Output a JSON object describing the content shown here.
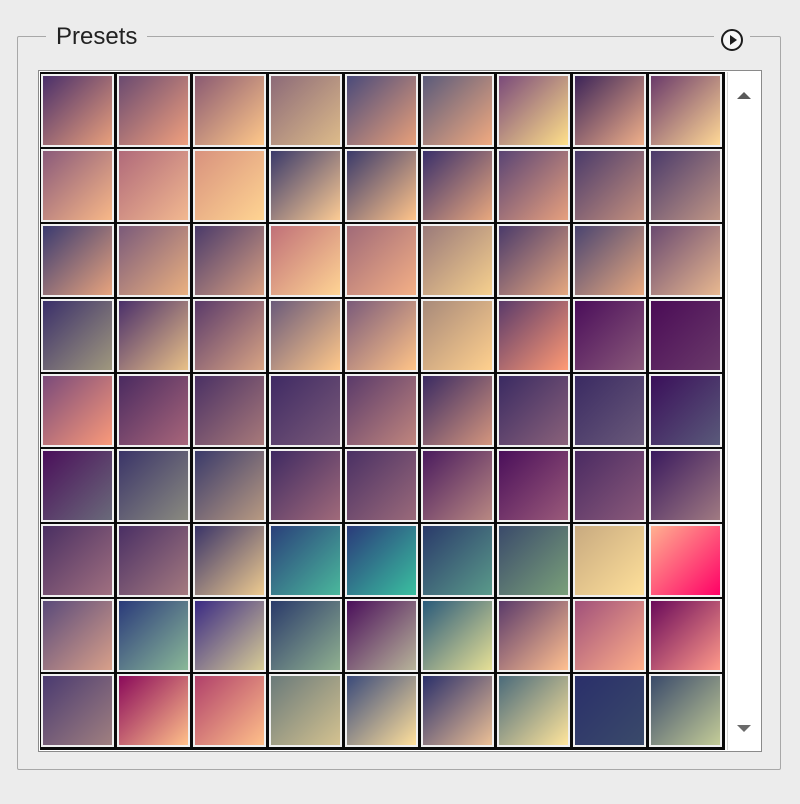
{
  "title": "Presets",
  "icons": {
    "menu": "circled-right-arrow-icon",
    "scroll_up": "triangle-up-icon",
    "scroll_down": "triangle-down-icon"
  },
  "swatches": [
    [
      "#4a2f6a",
      "#e9a07c"
    ],
    [
      "#6a4a70",
      "#f0a07e"
    ],
    [
      "#8a5a72",
      "#ffc88a"
    ],
    [
      "#8c6a78",
      "#ddbb8a"
    ],
    [
      "#4a4a7a",
      "#e8a07a"
    ],
    [
      "#5a5a7a",
      "#f1aa80"
    ],
    [
      "#7a4a7a",
      "#ffe08a"
    ],
    [
      "#3c2458",
      "#f0b08a"
    ],
    [
      "#6a3a6a",
      "#ffd896"
    ],
    [
      "#8a5a7a",
      "#f8b888"
    ],
    [
      "#b06a7a",
      "#f2b890"
    ],
    [
      "#d8927e",
      "#ffd492"
    ],
    [
      "#3a3a6a",
      "#fccb94"
    ],
    [
      "#3a3a6a",
      "#ffc48a"
    ],
    [
      "#3a2f6a",
      "#e8a87e"
    ],
    [
      "#5a4474",
      "#e6a07e"
    ],
    [
      "#4a3a6a",
      "#c4907e"
    ],
    [
      "#4a3a6a",
      "#c09686"
    ],
    [
      "#3a3a70",
      "#e8a47e"
    ],
    [
      "#7a5a7a",
      "#eab080"
    ],
    [
      "#4a3a6a",
      "#d8a082"
    ],
    [
      "#c07078",
      "#ffd494"
    ],
    [
      "#a06a78",
      "#f4b086"
    ],
    [
      "#9a7a7a",
      "#f6d08e"
    ],
    [
      "#4a3a6a",
      "#e6a880"
    ],
    [
      "#4a4470",
      "#e8aa80"
    ],
    [
      "#6a4a70",
      "#e8b890"
    ],
    [
      "#3a2f6a",
      "#a0987e"
    ],
    [
      "#4a2f6a",
      "#e8c088"
    ],
    [
      "#5a3a6a",
      "#d8a484"
    ],
    [
      "#6a5a7a",
      "#ffc88a"
    ],
    [
      "#7a5a7a",
      "#ffc488"
    ],
    [
      "#a88a7a",
      "#ffd08e"
    ],
    [
      "#5a3a6a",
      "#ff9a74"
    ],
    [
      "#4a0d5a",
      "#8a5a7a"
    ],
    [
      "#4a0b56",
      "#6a3a6a"
    ],
    [
      "#7a4a7a",
      "#fa9a7a"
    ],
    [
      "#4a2a60",
      "#a8667a"
    ],
    [
      "#4a3064",
      "#a87a7a"
    ],
    [
      "#3f2a64",
      "#7a5a78"
    ],
    [
      "#5a3a6a",
      "#c0867e"
    ],
    [
      "#3a2a62",
      "#d4967e"
    ],
    [
      "#3a2a62",
      "#8a627a"
    ],
    [
      "#3a2a62",
      "#6a5a7a"
    ],
    [
      "#3a0f5a",
      "#5a5a7a"
    ],
    [
      "#4a0f5a",
      "#6a6a7a"
    ],
    [
      "#3a3468",
      "#8a8a80"
    ],
    [
      "#3a3a6a",
      "#b89a82"
    ],
    [
      "#3f2a62",
      "#a06a7a"
    ],
    [
      "#4a3064",
      "#9a6a7a"
    ],
    [
      "#4a1b5e",
      "#b88882"
    ],
    [
      "#4a0f5a",
      "#9a5a7a"
    ],
    [
      "#4a2a62",
      "#8a5a7a"
    ],
    [
      "#3a1a5e",
      "#a07a82"
    ],
    [
      "#4a2f62",
      "#a07080"
    ],
    [
      "#4a2f64",
      "#a47a80"
    ],
    [
      "#3a3468",
      "#eecb90"
    ],
    [
      "#2a3f7a",
      "#4ab89c"
    ],
    [
      "#2a3a7a",
      "#3ac0a0"
    ],
    [
      "#2a3a6a",
      "#5a9a8a"
    ],
    [
      "#3a4a6a",
      "#7aa07a"
    ],
    [
      "#c8aa80",
      "#ffe09a"
    ],
    [
      "#ffb090",
      "#ff0066"
    ],
    [
      "#5a4a7a",
      "#d8a08a"
    ],
    [
      "#2a3a7a",
      "#8ab898"
    ],
    [
      "#3a2a84",
      "#d8cc96"
    ],
    [
      "#2a3a6a",
      "#90b090"
    ],
    [
      "#4a0f5a",
      "#b8b49a"
    ],
    [
      "#2a5a7a",
      "#e6e096"
    ],
    [
      "#5a3a6a",
      "#ffc090"
    ],
    [
      "#a0507a",
      "#ffb08a"
    ],
    [
      "#6a0a5a",
      "#ff9a8a"
    ],
    [
      "#4a3a70",
      "#a08080"
    ],
    [
      "#8a0a5a",
      "#ffc08a"
    ],
    [
      "#b0406a",
      "#ffc08a"
    ],
    [
      "#6a7a7a",
      "#d4c290"
    ],
    [
      "#3a4a7a",
      "#ffe09c"
    ],
    [
      "#2a2f6a",
      "#ecc096"
    ],
    [
      "#4a6a7a",
      "#ffe59c"
    ],
    [
      "#2a2f6a",
      "#3a4a6a"
    ],
    [
      "#3a4a6a",
      "#c4cc98"
    ]
  ]
}
